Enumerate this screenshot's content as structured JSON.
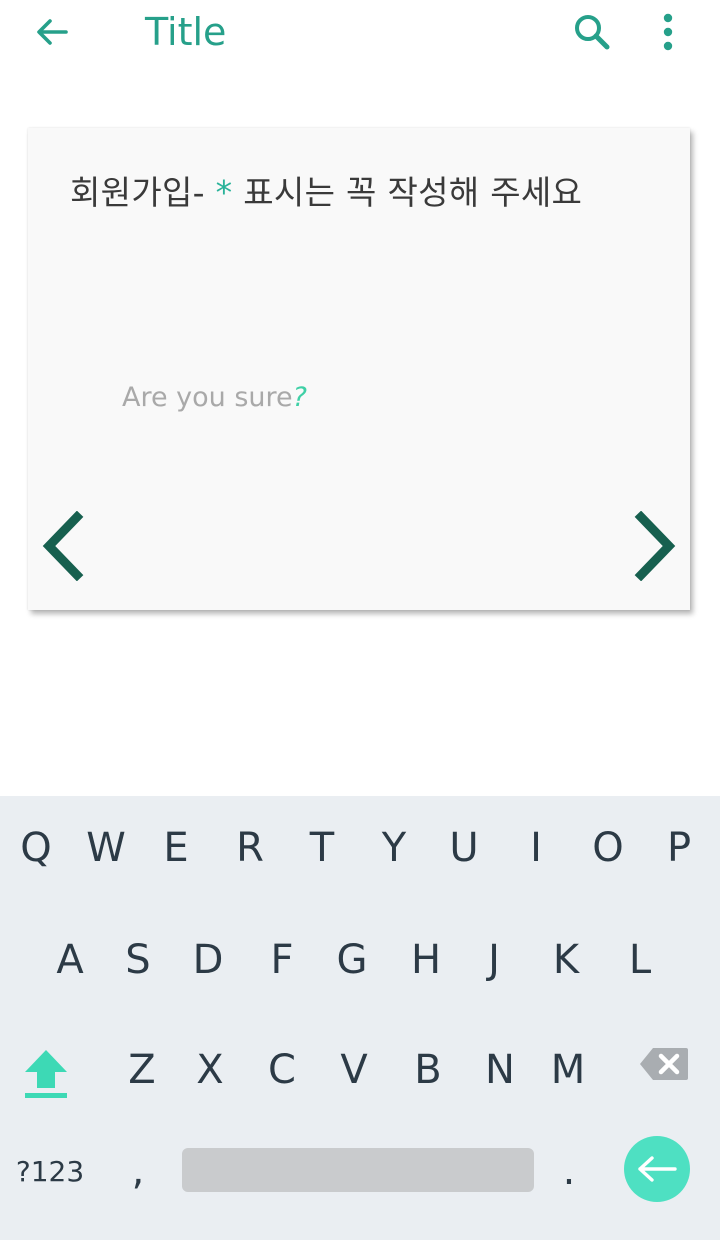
{
  "appbar": {
    "title": "Title",
    "back_icon": "arrow-left-icon",
    "search_icon": "search-icon",
    "more_icon": "more-vertical-icon",
    "accent_color": "#26a08a"
  },
  "card": {
    "heading_prefix": "회원가입- ",
    "heading_asterisk": "*",
    "heading_suffix": " 표시는 꼭 작성해 주세요",
    "question_text": "Are you sure",
    "question_mark": "?",
    "prev_icon": "chevron-left-icon",
    "next_icon": "chevron-right-icon",
    "arrow_color": "#17604f"
  },
  "keyboard": {
    "row1": [
      "Q",
      "W",
      "E",
      "R",
      "T",
      "Y",
      "U",
      "I",
      "O",
      "P"
    ],
    "row2": [
      "A",
      "S",
      "D",
      "F",
      "G",
      "H",
      "J",
      "K",
      "L"
    ],
    "row3": [
      "Z",
      "X",
      "C",
      "V",
      "B",
      "N",
      "M"
    ],
    "symbols_label": "?123",
    "comma_label": ",",
    "period_label": ".",
    "shift_icon": "shift-up-icon",
    "backspace_icon": "backspace-icon",
    "enter_icon": "enter-arrow-icon",
    "enter_color": "#4ee0c2"
  }
}
